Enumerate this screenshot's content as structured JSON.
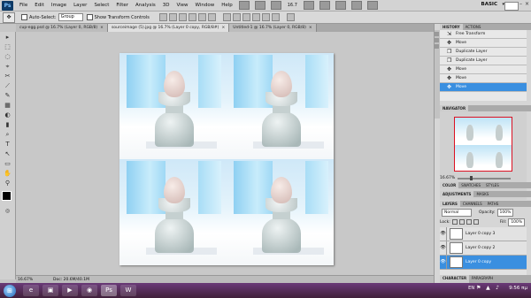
{
  "menubar": {
    "logo": "Ps",
    "items": [
      "File",
      "Edit",
      "Image",
      "Layer",
      "Select",
      "Filter",
      "Analysis",
      "3D",
      "View",
      "Window",
      "Help"
    ],
    "zoom": "16.7",
    "workspace": "BASIC",
    "workspace_arrow": "▾",
    "win_controls": [
      "–",
      "□",
      "×"
    ]
  },
  "options": {
    "tool_icon": "✥",
    "auto_select_label": "Auto-Select:",
    "auto_select_value": "Group",
    "transform_label": "Show Transform Controls"
  },
  "tabs": [
    {
      "label": "cup-egg.psd @ 16.7% (Layer 0, RGB/8)",
      "close": "×"
    },
    {
      "label": "sourceimage (5).jpg @ 16.7% (Layer 0 copy, RGB/8#)",
      "close": "×"
    },
    {
      "label": "Untitled-1 @ 16.7% (Layer 0, RGB/8)",
      "close": "×"
    }
  ],
  "tools": [
    "▸",
    "⬚",
    "◌",
    "⌖",
    "✂",
    "⟋",
    "✎",
    "▦",
    "◐",
    "▮",
    "⌕",
    "T",
    "↖",
    "▭",
    "✋",
    "⚲"
  ],
  "status": {
    "zoom": "16.67%",
    "doc": "Doc: 20.6M/40.1M"
  },
  "history": {
    "tabs": [
      "HISTORY",
      "ACTIONS"
    ],
    "items": [
      {
        "label": "Free Transform",
        "icon": "⇲"
      },
      {
        "label": "Move",
        "icon": "✥"
      },
      {
        "label": "Duplicate Layer",
        "icon": "❐"
      },
      {
        "label": "Duplicate Layer",
        "icon": "❐"
      },
      {
        "label": "Move",
        "icon": "✥"
      },
      {
        "label": "Move",
        "icon": "✥"
      },
      {
        "label": "Move",
        "icon": "✥"
      }
    ]
  },
  "navigator": {
    "tabs": [
      "NAVIGATOR"
    ],
    "zoom": "16.67%"
  },
  "color_tabs": [
    "COLOR",
    "SWATCHES",
    "STYLES"
  ],
  "adjust_tabs": [
    "ADJUSTMENTS",
    "MASKS"
  ],
  "layers": {
    "tabs": [
      "LAYERS",
      "CHANNELS",
      "PATHS"
    ],
    "blend_mode": "Normal",
    "opacity_label": "Opacity:",
    "opacity": "100%",
    "lock_label": "Lock:",
    "fill_label": "Fill:",
    "fill": "100%",
    "rows": [
      {
        "name": "Layer 0 copy 3",
        "eye": "👁"
      },
      {
        "name": "Layer 0 copy 2",
        "eye": "👁"
      },
      {
        "name": "Layer 0 copy",
        "eye": "👁"
      }
    ]
  },
  "char_tabs": [
    "CHARACTER",
    "PARAGRAPH"
  ],
  "taskbar": {
    "start": "⊞",
    "apps": [
      {
        "icon": "e",
        "name": "ie"
      },
      {
        "icon": "▣",
        "name": "explorer"
      },
      {
        "icon": "▶",
        "name": "media"
      },
      {
        "icon": "◉",
        "name": "chrome"
      },
      {
        "icon": "Ps",
        "name": "photoshop"
      },
      {
        "icon": "W",
        "name": "word"
      }
    ],
    "lang": "EN",
    "clock": "9:56 πμ"
  },
  "colors": {
    "selection": "#3a8fe0",
    "nav_frame": "#dd1122"
  }
}
